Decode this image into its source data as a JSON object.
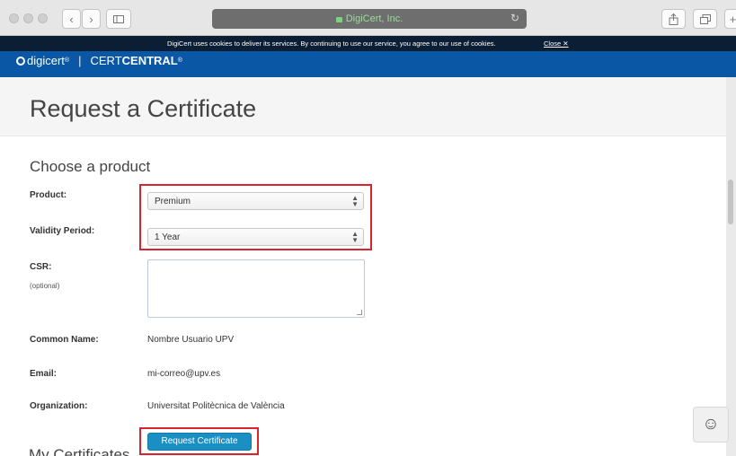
{
  "browser": {
    "url_display": "DigiCert, Inc.",
    "back_icon": "chevron-left-icon",
    "forward_icon": "chevron-right-icon",
    "sidebar_icon": "sidebar-icon",
    "reload_icon": "reload-icon",
    "share_icon": "share-icon",
    "tabs_icon": "tabs-icon"
  },
  "cookie_banner": {
    "text": "DigiCert uses cookies to deliver its services. By continuing to use our service, you agree to our use of cookies.",
    "close_label": "Close ✕"
  },
  "brand": {
    "logo_text": "digicert",
    "logo_mark": "®",
    "separator": "|",
    "product_prefix": "CERT",
    "product_bold": "CENTRAL",
    "product_mark": "®"
  },
  "page": {
    "title": "Request a Certificate"
  },
  "form": {
    "section_title": "Choose a product",
    "product_label": "Product:",
    "product_value": "Premium",
    "validity_label": "Validity Period:",
    "validity_value": "1 Year",
    "csr_label": "CSR:",
    "csr_optional": "(optional)",
    "common_name_label": "Common Name:",
    "common_name_value": "Nombre Usuario UPV",
    "email_label": "Email:",
    "email_value": "mi-correo@upv.es",
    "organization_label": "Organization:",
    "organization_value": "Universitat Politècnica de València",
    "submit_label": "Request Certificate"
  },
  "next_section": {
    "title": "My Certificates"
  },
  "colors": {
    "brand_blue": "#0a58a5",
    "cookie_bar": "#0b1e33",
    "button_blue": "#1a8fc4",
    "highlight_red": "#d9232d"
  }
}
